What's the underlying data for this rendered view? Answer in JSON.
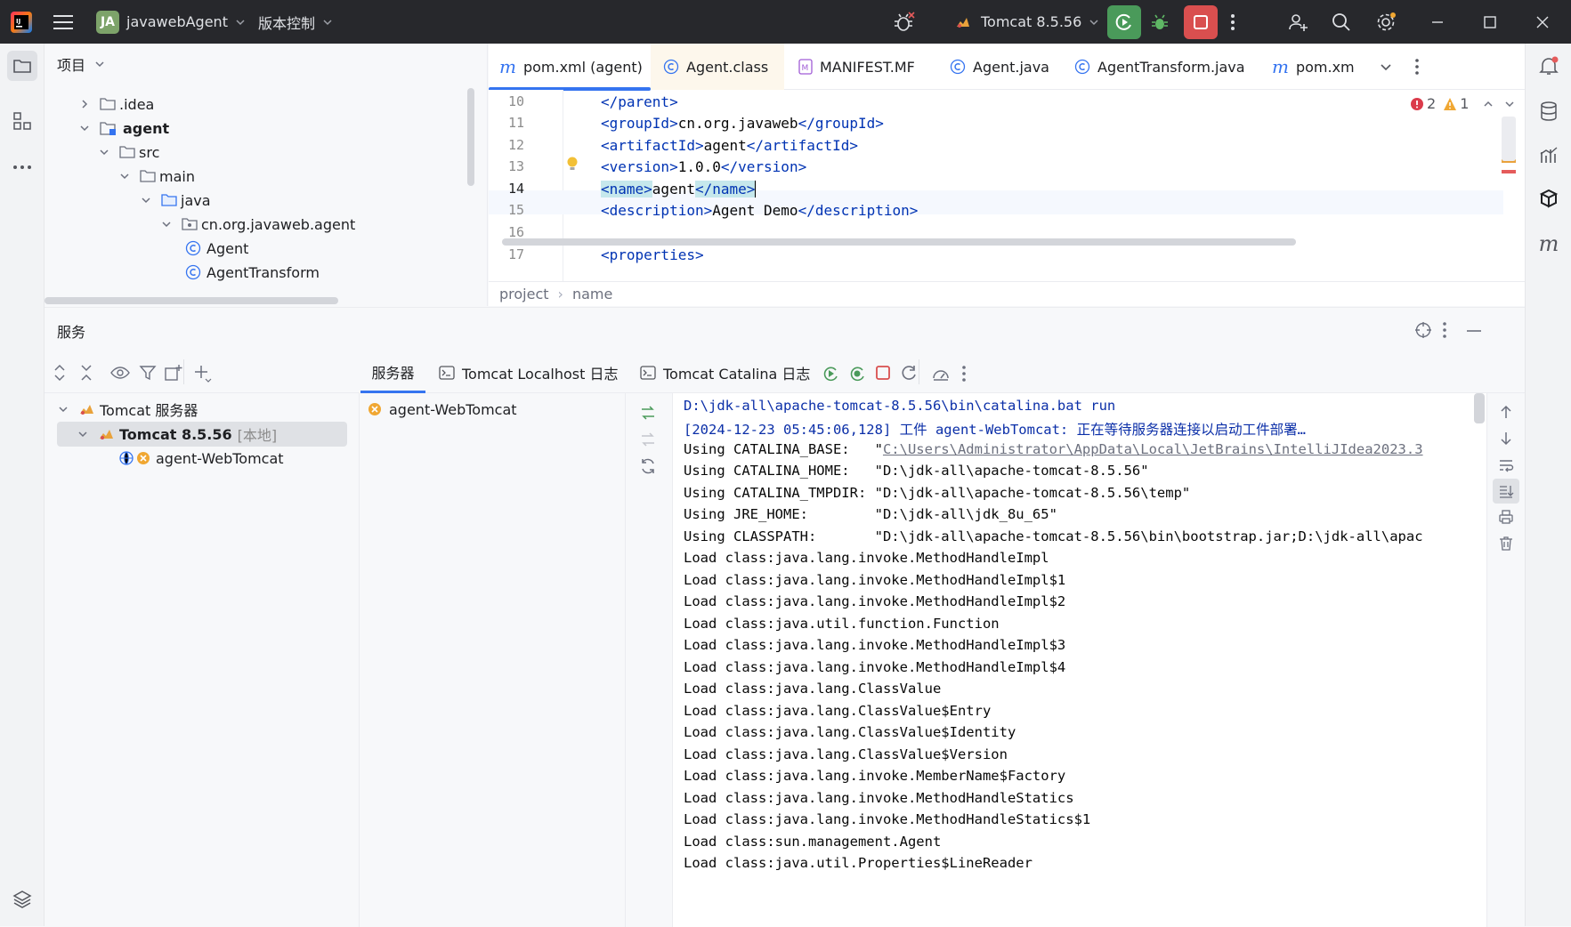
{
  "titlebar": {
    "project_badge": "JA",
    "project_name": "javawebAgent",
    "vcs_label": "版本控制",
    "run_config": "Tomcat 8.5.56",
    "colors": {
      "bg": "#27282c",
      "run_green": "#4a9a5a",
      "stop_red": "#d94f4f",
      "badge": "#7da36a"
    }
  },
  "left_stripe": {
    "icons": [
      "folder-icon",
      "structure-icon",
      "more-icon",
      "layers-icon"
    ]
  },
  "right_stripe": {
    "icons": [
      "notifications-icon",
      "database-icon",
      "profiler-icon",
      "plugin-icon",
      "maven-icon"
    ]
  },
  "project_panel": {
    "title": "项目",
    "tree": [
      {
        "label": ".idea",
        "kind": "folder",
        "expanded": false
      },
      {
        "label": "agent",
        "kind": "module",
        "expanded": true
      },
      {
        "label": "src",
        "kind": "folder",
        "expanded": true
      },
      {
        "label": "main",
        "kind": "folder",
        "expanded": true
      },
      {
        "label": "java",
        "kind": "source-folder",
        "expanded": true
      },
      {
        "label": "cn.org.javaweb.agent",
        "kind": "package",
        "expanded": true
      },
      {
        "label": "Agent",
        "kind": "class"
      },
      {
        "label": "AgentTransform",
        "kind": "class"
      }
    ]
  },
  "editor": {
    "tabs": [
      {
        "label": "pom.xml (agent)",
        "icon": "maven-icon",
        "active": true
      },
      {
        "label": "Agent.class",
        "icon": "class-icon",
        "active": false
      },
      {
        "label": "MANIFEST.MF",
        "icon": "manifest-icon",
        "active": false
      },
      {
        "label": "Agent.java",
        "icon": "class-icon",
        "active": false
      },
      {
        "label": "AgentTransform.java",
        "icon": "class-icon",
        "active": false
      },
      {
        "label": "pom.xml (",
        "icon": "maven-icon",
        "active": false
      }
    ],
    "inspections": {
      "errors": "2",
      "warnings": "1"
    },
    "lines": [
      {
        "no": "10",
        "open": "</parent>",
        "text": "",
        "close": ""
      },
      {
        "no": "11",
        "open": "<groupId>",
        "text": "cn.org.javaweb",
        "close": "</groupId>"
      },
      {
        "no": "12",
        "open": "<artifactId>",
        "text": "agent",
        "close": "</artifactId>"
      },
      {
        "no": "13",
        "open": "<version>",
        "text": "1.0.0",
        "close": "</version>"
      },
      {
        "no": "14",
        "open": "<name>",
        "text": "agent",
        "close": "</name>"
      },
      {
        "no": "15",
        "open": "<description>",
        "text": "Agent Demo",
        "close": "</description>"
      },
      {
        "no": "16",
        "open": "",
        "text": "",
        "close": ""
      },
      {
        "no": "17",
        "open": "<properties>",
        "text": "",
        "close": ""
      }
    ],
    "breadcrumb": [
      "project",
      "name"
    ]
  },
  "services": {
    "title": "服务",
    "tree": [
      {
        "label": "Tomcat 服务器",
        "suffix": ""
      },
      {
        "label": "Tomcat 8.5.56",
        "suffix": "[本地]"
      },
      {
        "label": "agent-WebTomcat",
        "suffix": ""
      }
    ],
    "tabs": [
      "服务器",
      "Tomcat Localhost 日志",
      "Tomcat Catalina 日志"
    ],
    "deployment": "agent-WebTomcat",
    "console": [
      {
        "text": "D:\\jdk-all\\apache-tomcat-8.5.56\\bin\\catalina.bat run",
        "kind": "cmd"
      },
      {
        "text": "[2024-12-23 05:45:06,128] 工件 agent-WebTomcat: 正在等待服务器连接以启动工件部署…",
        "kind": "cmd"
      },
      {
        "text": "Using CATALINA_BASE:   \"",
        "link": "C:\\Users\\Administrator\\AppData\\Local\\JetBrains\\IntelliJIdea2023.3",
        "kind": "link"
      },
      {
        "text": "Using CATALINA_HOME:   \"D:\\jdk-all\\apache-tomcat-8.5.56\"",
        "kind": "out"
      },
      {
        "text": "Using CATALINA_TMPDIR: \"D:\\jdk-all\\apache-tomcat-8.5.56\\temp\"",
        "kind": "out"
      },
      {
        "text": "Using JRE_HOME:        \"D:\\jdk-all\\jdk_8u_65\"",
        "kind": "out"
      },
      {
        "text": "Using CLASSPATH:       \"D:\\jdk-all\\apache-tomcat-8.5.56\\bin\\bootstrap.jar;D:\\jdk-all\\apac",
        "kind": "out"
      },
      {
        "text": "Load class:java.lang.invoke.MethodHandleImpl",
        "kind": "out"
      },
      {
        "text": "Load class:java.lang.invoke.MethodHandleImpl$1",
        "kind": "out"
      },
      {
        "text": "Load class:java.lang.invoke.MethodHandleImpl$2",
        "kind": "out"
      },
      {
        "text": "Load class:java.util.function.Function",
        "kind": "out"
      },
      {
        "text": "Load class:java.lang.invoke.MethodHandleImpl$3",
        "kind": "out"
      },
      {
        "text": "Load class:java.lang.invoke.MethodHandleImpl$4",
        "kind": "out"
      },
      {
        "text": "Load class:java.lang.ClassValue",
        "kind": "out"
      },
      {
        "text": "Load class:java.lang.ClassValue$Entry",
        "kind": "out"
      },
      {
        "text": "Load class:java.lang.ClassValue$Identity",
        "kind": "out"
      },
      {
        "text": "Load class:java.lang.ClassValue$Version",
        "kind": "out"
      },
      {
        "text": "Load class:java.lang.invoke.MemberName$Factory",
        "kind": "out"
      },
      {
        "text": "Load class:java.lang.invoke.MethodHandleStatics",
        "kind": "out"
      },
      {
        "text": "Load class:java.lang.invoke.MethodHandleStatics$1",
        "kind": "out"
      },
      {
        "text": "Load class:sun.management.Agent",
        "kind": "out"
      },
      {
        "text": "Load class:java.util.Properties$LineReader",
        "kind": "out"
      }
    ]
  }
}
